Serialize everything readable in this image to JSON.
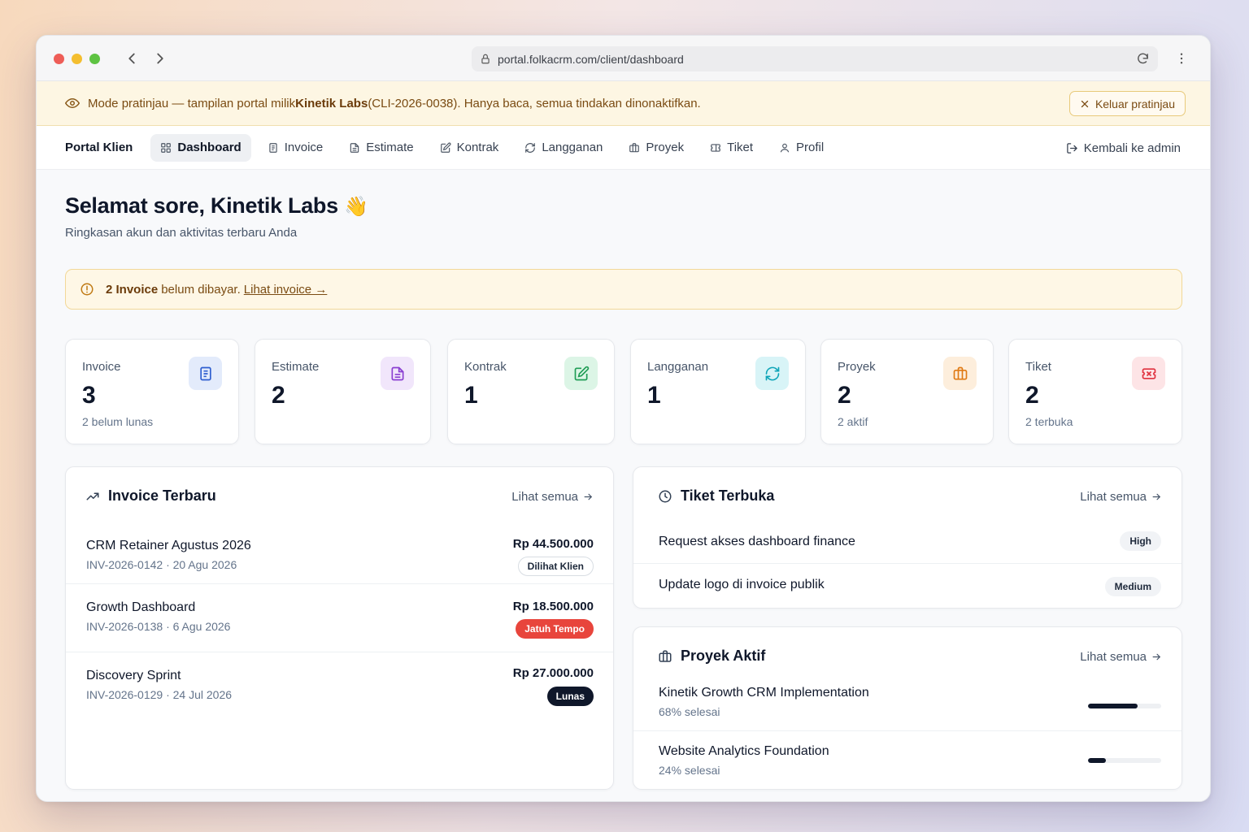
{
  "browser": {
    "url": "portal.folkacrm.com/client/dashboard"
  },
  "banner": {
    "text_prefix": "Mode pratinjau — tampilan portal milik ",
    "client_name": "Kinetik Labs",
    "text_suffix": " (CLI-2026-0038). Hanya baca, semua tindakan dinonaktifkan.",
    "exit_label": "Keluar pratinjau"
  },
  "nav": {
    "brand": "Portal Klien",
    "items": [
      {
        "label": "Dashboard",
        "icon": "grid-icon",
        "active": true
      },
      {
        "label": "Invoice",
        "icon": "file-icon",
        "active": false
      },
      {
        "label": "Estimate",
        "icon": "file-text-icon",
        "active": false
      },
      {
        "label": "Kontrak",
        "icon": "edit-icon",
        "active": false
      },
      {
        "label": "Langganan",
        "icon": "refresh-icon",
        "active": false
      },
      {
        "label": "Proyek",
        "icon": "briefcase-icon",
        "active": false
      },
      {
        "label": "Tiket",
        "icon": "ticket-icon",
        "active": false
      },
      {
        "label": "Profil",
        "icon": "user-icon",
        "active": false
      }
    ],
    "back_admin": "Kembali ke admin"
  },
  "page": {
    "greeting": "Selamat sore, Kinetik Labs",
    "wave": "👋",
    "subtitle": "Ringkasan akun dan aktivitas terbaru Anda"
  },
  "alert": {
    "bold": "2 Invoice",
    "text": "belum dibayar.",
    "link": "Lihat invoice →"
  },
  "stats": [
    {
      "label": "Invoice",
      "value": "3",
      "sub": "2 belum lunas",
      "icon": "file-icon",
      "color": "#2f5fd0",
      "bg": "#e3ebfb"
    },
    {
      "label": "Estimate",
      "value": "2",
      "sub": "",
      "icon": "file-text-icon",
      "color": "#8a3fd1",
      "bg": "#f1e6fb"
    },
    {
      "label": "Kontrak",
      "value": "1",
      "sub": "",
      "icon": "edit-icon",
      "color": "#1f9d55",
      "bg": "#dcf5e6"
    },
    {
      "label": "Langganan",
      "value": "1",
      "sub": "",
      "icon": "refresh-icon",
      "color": "#0ea5b8",
      "bg": "#d8f4f7"
    },
    {
      "label": "Proyek",
      "value": "2",
      "sub": "2 aktif",
      "icon": "briefcase-icon",
      "color": "#e07a14",
      "bg": "#fdeedc"
    },
    {
      "label": "Tiket",
      "value": "2",
      "sub": "2 terbuka",
      "icon": "ticket-icon",
      "color": "#e0323f",
      "bg": "#fde4e6"
    }
  ],
  "invoices": {
    "title": "Invoice Terbaru",
    "see_all": "Lihat semua",
    "rows": [
      {
        "name": "CRM Retainer Agustus 2026",
        "meta": "INV-2026-0142 · 20 Agu 2026",
        "amount": "Rp 44.500.000",
        "status": "Dilihat Klien"
      },
      {
        "name": "Growth Dashboard",
        "meta": "INV-2026-0138 · 6 Agu 2026",
        "amount": "Rp 18.500.000",
        "status": "Jatuh Tempo"
      },
      {
        "name": "Discovery Sprint",
        "meta": "INV-2026-0129 · 24 Jul 2026",
        "amount": "Rp 27.000.000",
        "status": "Lunas"
      }
    ]
  },
  "tickets": {
    "title": "Tiket Terbuka",
    "see_all": "Lihat semua",
    "rows": [
      {
        "name": "Request akses dashboard finance",
        "priority": "High"
      },
      {
        "name": "Update logo di invoice publik",
        "priority": "Medium"
      }
    ]
  },
  "projects": {
    "title": "Proyek Aktif",
    "see_all": "Lihat semua",
    "rows": [
      {
        "name": "Kinetik Growth CRM Implementation",
        "sub": "68% selesai",
        "progress": 68
      },
      {
        "name": "Website Analytics Foundation",
        "sub": "24% selesai",
        "progress": 24
      }
    ]
  }
}
